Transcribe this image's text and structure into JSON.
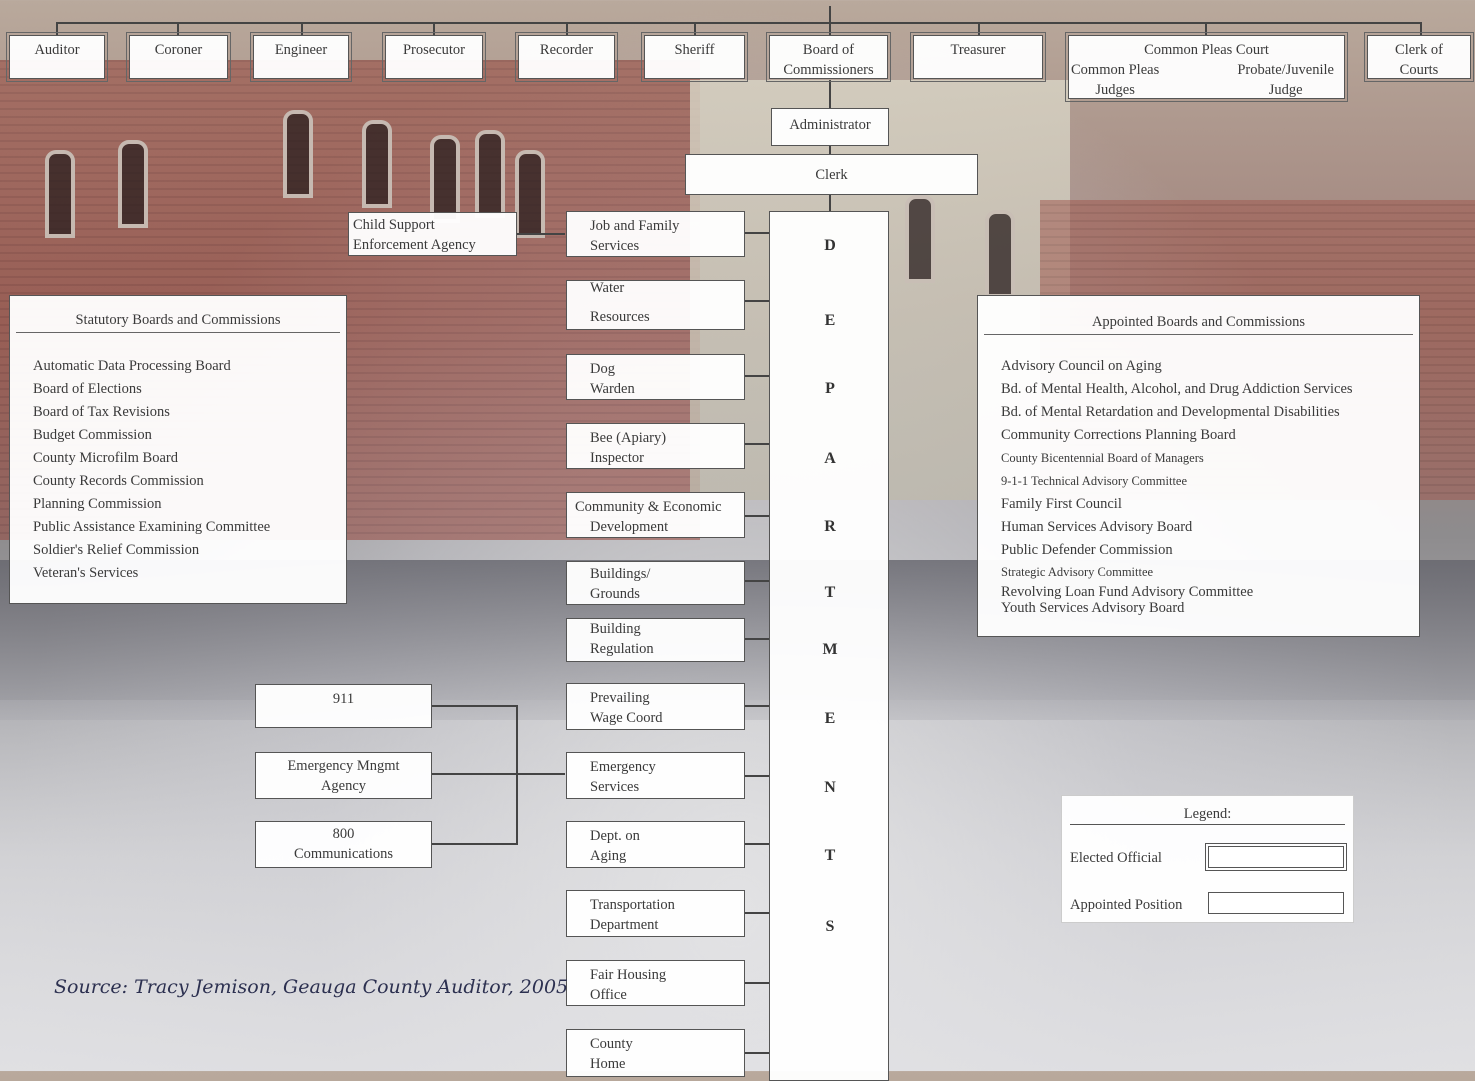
{
  "elected_officials": {
    "auditor": "Auditor",
    "coroner": "Coroner",
    "engineer": "Engineer",
    "prosecutor": "Prosecutor",
    "recorder": "Recorder",
    "sheriff": "Sheriff",
    "board_of_commissioners": [
      "Board of",
      "Commissioners"
    ],
    "treasurer": "Treasurer",
    "common_pleas_court": {
      "title": "Common Pleas Court",
      "left": [
        "Common Pleas",
        "Judges"
      ],
      "right": [
        "Probate/Juvenile",
        "Judge"
      ]
    },
    "clerk_of_courts": [
      "Clerk of",
      "Courts"
    ]
  },
  "administrator": "Administrator",
  "clerk": "Clerk",
  "child_support": [
    "Child Support",
    "Enforcement Agency"
  ],
  "departments_label": [
    "D",
    "E",
    "P",
    "A",
    "R",
    "T",
    "M",
    "E",
    "N",
    "T",
    "S"
  ],
  "departments": [
    [
      "Job and Family",
      "Services"
    ],
    [
      "Water",
      "Resources"
    ],
    [
      "Dog",
      "Warden"
    ],
    [
      "Bee (Apiary)",
      "Inspector"
    ],
    [
      "Community & Economic",
      "Development"
    ],
    [
      "Buildings/",
      "Grounds"
    ],
    [
      "Building",
      "Regulation"
    ],
    [
      "Prevailing",
      "Wage Coord"
    ],
    [
      "Emergency",
      "Services"
    ],
    [
      "Dept. on",
      "Aging"
    ],
    [
      "Transportation",
      "Department"
    ],
    [
      "Fair Housing",
      "Office"
    ],
    [
      "County",
      "Home"
    ]
  ],
  "emergency_units": {
    "unit_911": "911",
    "ema": [
      "Emergency Mngmt",
      "Agency"
    ],
    "comm_800": [
      "800",
      "Communications"
    ]
  },
  "statutory": {
    "title": "Statutory Boards and Commissions",
    "items": [
      "Automatic Data Processing Board",
      "Board of Elections",
      "Board of Tax Revisions",
      "Budget Commission",
      "County Microfilm Board",
      "County Records Commission",
      "Planning Commission",
      "Public Assistance Examining Committee",
      "Soldier's Relief Commission",
      "Veteran's Services"
    ]
  },
  "appointed": {
    "title": "Appointed Boards and Commissions",
    "items": [
      "Advisory Council on Aging",
      "Bd. of Mental Health, Alcohol, and Drug Addiction Services",
      "Bd. of Mental Retardation and Developmental Disabilities",
      "Community Corrections Planning Board",
      "County Bicentennial Board of Managers",
      "9-1-1 Technical Advisory Committee",
      "Family First Council",
      "Human Services Advisory Board",
      "Public Defender Commission",
      "Strategic Advisory Committee",
      "Revolving Loan Fund Advisory Committee",
      "Youth Services Advisory Board"
    ]
  },
  "legend": {
    "title": "Legend:",
    "elected": "Elected Official",
    "appointed": "Appointed Position"
  },
  "source": "Source: Tracy Jemison, Geauga County Auditor, 2005"
}
